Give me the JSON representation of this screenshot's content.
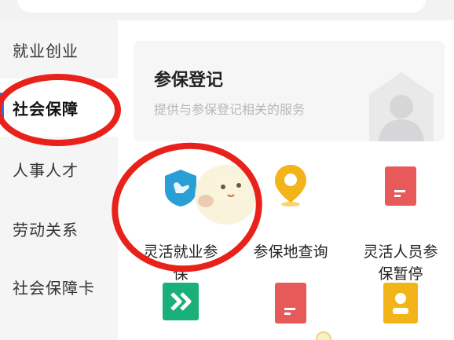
{
  "sidebar": {
    "items": [
      {
        "label": "就业创业",
        "active": false
      },
      {
        "label": "社会保障",
        "active": true
      },
      {
        "label": "人事人才",
        "active": false
      },
      {
        "label": "劳动关系",
        "active": false
      },
      {
        "label": "社会保障卡",
        "active": false
      }
    ]
  },
  "banner": {
    "title": "参保登记",
    "subtitle": "提供与参保登记相关的服务",
    "icon": "building-avatar-icon"
  },
  "services": [
    {
      "label_line1": "灵活就业参",
      "label_line2": "保",
      "icon": "shield-hand-icon",
      "color": "#2a9fd6"
    },
    {
      "label_line1": "参保地查询",
      "label_line2": "",
      "icon": "location-pin-icon",
      "color": "#f3b419"
    },
    {
      "label_line1": "灵活人员参",
      "label_line2": "保暂停",
      "icon": "document-red-icon",
      "color": "#e85a5a"
    },
    {
      "label_line1": "",
      "label_line2": "",
      "icon": "double-chevron-icon",
      "color": "#19b07a"
    },
    {
      "label_line1": "",
      "label_line2": "",
      "icon": "document-red-icon",
      "color": "#e85a5a"
    },
    {
      "label_line1": "",
      "label_line2": "",
      "icon": "id-card-icon",
      "color": "#f3b419"
    }
  ],
  "colors": {
    "accent": "#2f6fe0",
    "annotation_circle": "#e8221a"
  }
}
